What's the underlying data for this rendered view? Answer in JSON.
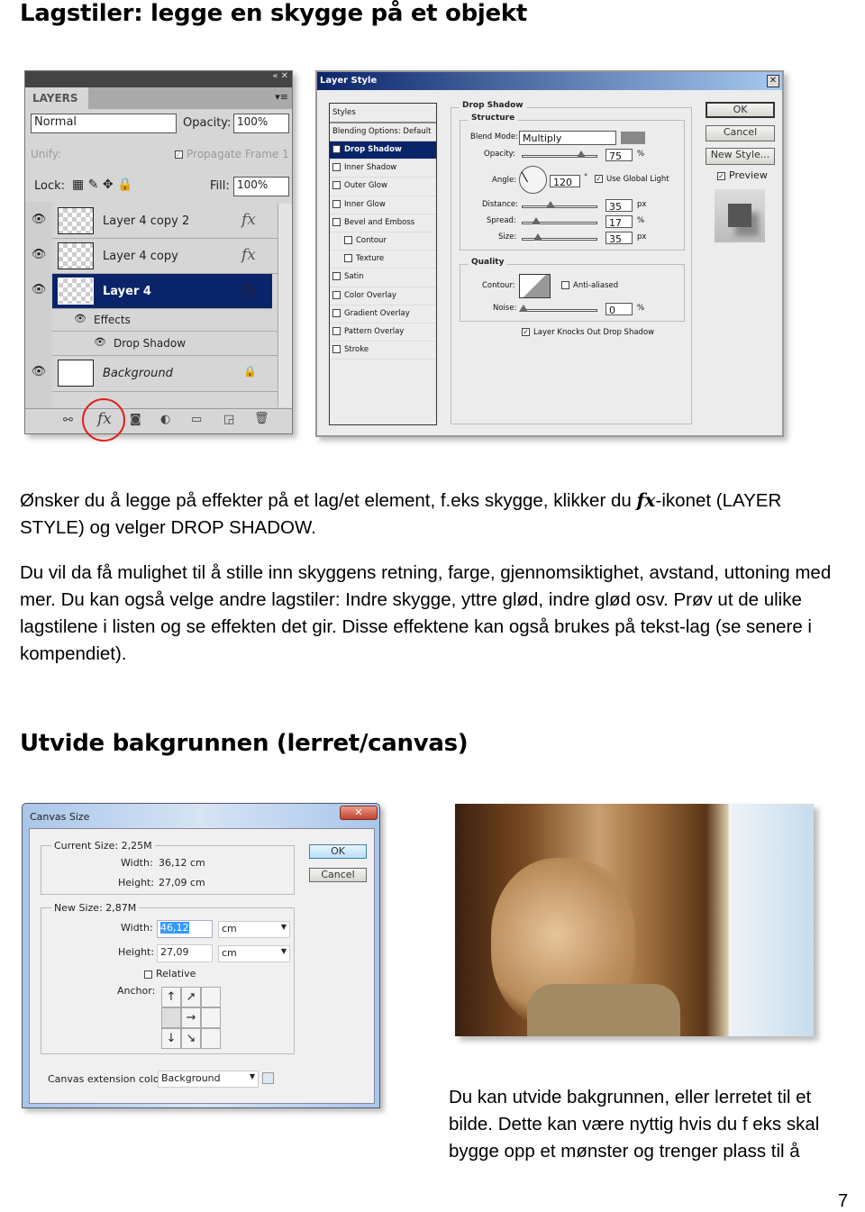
{
  "heading1": "Lagstiler: legge en skygge på et objekt",
  "layers_panel": {
    "tab": "LAYERS",
    "blend_mode": "Normal",
    "opacity_label": "Opacity:",
    "opacity": "100%",
    "unify_label": "Unify:",
    "propagate_label": "Propagate Frame 1",
    "lock_label": "Lock:",
    "fill_label": "Fill:",
    "fill": "100%",
    "layers": [
      {
        "name": "Layer 4 copy 2",
        "fx": "fx"
      },
      {
        "name": "Layer 4 copy",
        "fx": "fx"
      },
      {
        "name": "Layer 4",
        "fx": "fx",
        "selected": true
      }
    ],
    "effects_label": "Effects",
    "drop_shadow_label": "Drop Shadow",
    "background_label": "Background",
    "fx_button": "fx",
    "highlight_color": "#e0201c",
    "selected_color": "#0a246a"
  },
  "layer_style": {
    "title": "Layer Style",
    "styles_header": "Styles",
    "blending_options": "Blending Options: Default",
    "items": [
      {
        "label": "Drop Shadow",
        "checked": true,
        "selected": true
      },
      {
        "label": "Inner Shadow"
      },
      {
        "label": "Outer Glow"
      },
      {
        "label": "Inner Glow"
      },
      {
        "label": "Bevel and Emboss"
      },
      {
        "label": "Contour",
        "indent": true
      },
      {
        "label": "Texture",
        "indent": true
      },
      {
        "label": "Satin"
      },
      {
        "label": "Color Overlay"
      },
      {
        "label": "Gradient Overlay"
      },
      {
        "label": "Pattern Overlay"
      },
      {
        "label": "Stroke"
      }
    ],
    "section": "Drop Shadow",
    "structure": "Structure",
    "blend_mode_label": "Blend Mode:",
    "blend_mode": "Multiply",
    "opacity_label": "Opacity:",
    "opacity": "75",
    "opacity_unit": "%",
    "angle_label": "Angle:",
    "angle": "120",
    "angle_unit": "°",
    "global_light": "Use Global Light",
    "distance_label": "Distance:",
    "distance": "35",
    "distance_unit": "px",
    "spread_label": "Spread:",
    "spread": "17",
    "spread_unit": "%",
    "size_label": "Size:",
    "size": "35",
    "size_unit": "px",
    "quality": "Quality",
    "contour_label": "Contour:",
    "anti_aliased": "Anti-aliased",
    "noise_label": "Noise:",
    "noise": "0",
    "noise_unit": "%",
    "knockout": "Layer Knocks Out Drop Shadow",
    "ok": "OK",
    "cancel": "Cancel",
    "new_style": "New Style...",
    "preview": "Preview"
  },
  "paragraph1": [
    "Ønsker du å legge på effekter på et lag/et element, f.eks skygge, klikker du ",
    "fx",
    "-ikonet (LAYER STYLE) og velger DROP SHADOW."
  ],
  "paragraph2": "Du vil da få mulighet til å stille inn skyggens retning, farge, gjennomsiktighet, avstand, uttoning med mer.  Du kan også velge andre lagstiler: Indre skygge, yttre glød, indre glød osv. Prøv ut de ulike lagstilene i listen og se effekten det gir. Disse effektene kan også brukes på tekst-lag (se senere i kompendiet).",
  "heading2": "Utvide bakgrunnen (lerret/canvas)",
  "canvas_size": {
    "title": "Canvas Size",
    "current_size": "Current Size: 2,25M",
    "width_label": "Width:",
    "current_width": "36,12 cm",
    "height_label": "Height:",
    "current_height": "27,09 cm",
    "new_size": "New Size: 2,87M",
    "new_width": "46,12",
    "new_height": "27,09",
    "unit": "cm",
    "relative": "Relative",
    "anchor_label": "Anchor:",
    "anchor_arrows": [
      "↑",
      "↗",
      "",
      "",
      "→",
      "",
      "↓",
      "↘",
      ""
    ],
    "extension_label": "Canvas extension color:",
    "extension_value": "Background",
    "ok": "OK",
    "cancel": "Cancel"
  },
  "paragraph3": "Du kan utvide bakgrunnen, eller lerretet til et bilde. Dette kan være nyttig hvis du f eks skal bygge opp et mønster og trenger plass til å",
  "page_number": "7"
}
